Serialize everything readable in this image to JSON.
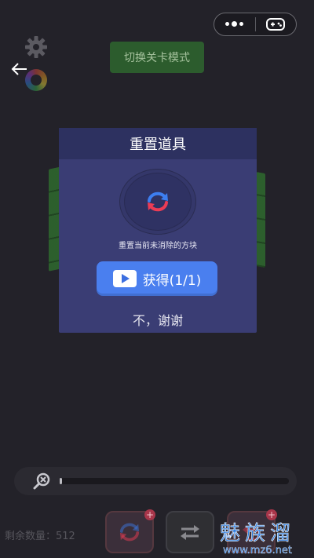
{
  "top_bar": {
    "capsule_menu_icon": "more-dots-icon",
    "capsule_game_icon": "gamepad-icon"
  },
  "header": {
    "mode_button_label": "切换关卡模式"
  },
  "dialog": {
    "title": "重置道具",
    "icon": "refresh-icon",
    "description": "重置当前未消除的方块",
    "obtain_label": "获得(1/1)",
    "dismiss_label": "不，谢谢"
  },
  "progress": {
    "value": 0.01
  },
  "footer": {
    "remaining_label": "剩余数量：",
    "remaining_count": "512"
  },
  "watermark": {
    "title": "魅族溜",
    "url": "www.mz6.net"
  },
  "colors": {
    "background": "#232229",
    "dialog_bg": "#3a3d74",
    "dialog_header_bg": "#2d3160",
    "primary_button": "#4a7fef",
    "mode_button": "#2f6b2f"
  }
}
